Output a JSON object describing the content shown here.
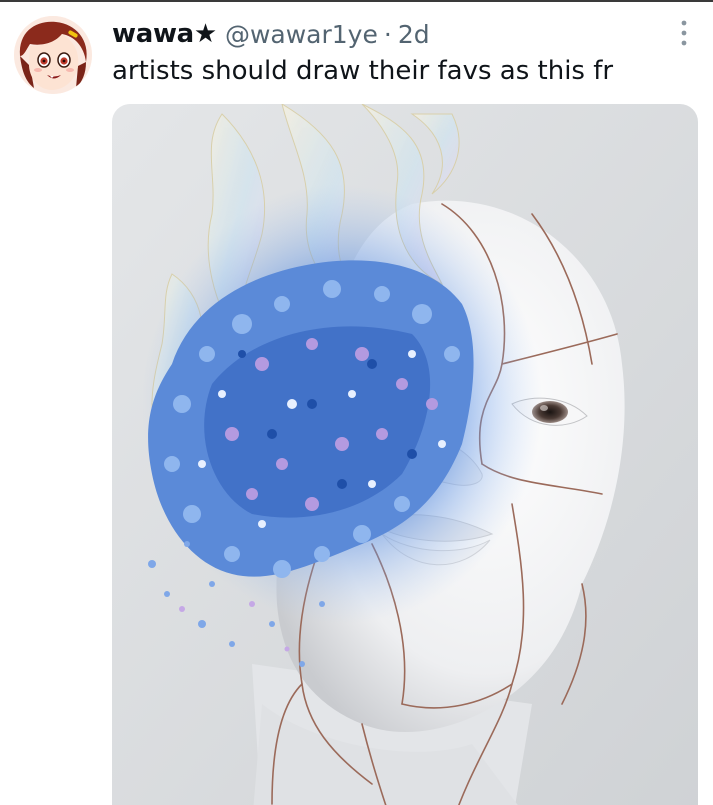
{
  "post": {
    "author": {
      "display_name": "wawa★",
      "handle": "@wawar1ye",
      "avatar_icon": "anime-character-avatar"
    },
    "separator": "·",
    "time_ago": "2d",
    "text": "artists should draw their favs as this fr",
    "more_icon": "vertical-ellipsis-icon",
    "media": {
      "kind": "photo",
      "subject": "white mannequin head with blue flowers and splash"
    }
  },
  "colors": {
    "text_primary": "#0f1419",
    "text_secondary": "#536471",
    "background": "#ffffff",
    "flower_blue": "#4a7fd4"
  }
}
